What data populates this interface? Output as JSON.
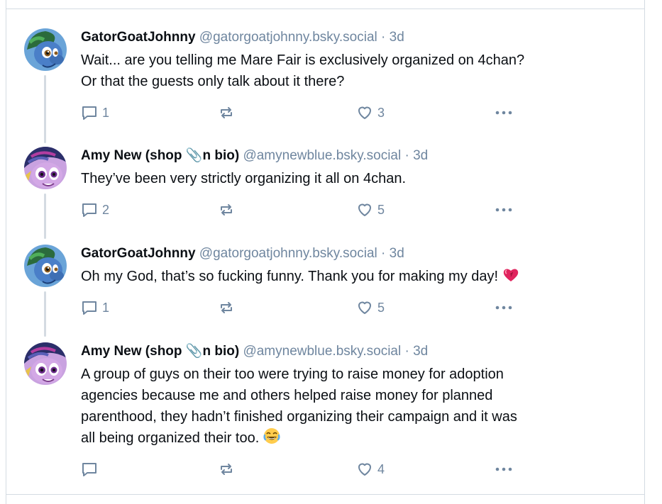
{
  "posts": [
    {
      "name": "GatorGoatJohnny",
      "handle": "@gatorgoatjohnny.bsky.social",
      "sep": "·",
      "time": "3d",
      "lines": [
        "Wait... are you telling me Mare Fair is exclusively organized on 4chan?",
        "Or that the guests only talk about it there?"
      ],
      "replies": "1",
      "reposts": "",
      "likes": "3"
    },
    {
      "name": "Amy New (shop 📎n bio)",
      "handle": "@amynewblue.bsky.social",
      "sep": "·",
      "time": "3d",
      "lines": [
        "They’ve been very strictly organizing it all on 4chan."
      ],
      "replies": "2",
      "reposts": "",
      "likes": "5"
    },
    {
      "name": "GatorGoatJohnny",
      "handle": "@gatorgoatjohnny.bsky.social",
      "sep": "·",
      "time": "3d",
      "lines": [
        "Oh my God, that’s so fucking funny. Thank you for making my day!"
      ],
      "replies": "1",
      "reposts": "",
      "likes": "5"
    },
    {
      "name": "Amy New (shop 📎n bio)",
      "handle": "@amynewblue.bsky.social",
      "sep": "·",
      "time": "3d",
      "lines": [
        "A group of guys on their too were trying to raise money for adoption",
        "agencies because me and others helped raise money for planned",
        "parenthood, they hadn’t finished organizing their campaign and it was",
        "all being organized their too."
      ],
      "replies": "",
      "reposts": "",
      "likes": "4"
    }
  ],
  "icons": {
    "reply": "reply-icon",
    "repost": "repost-icon",
    "like": "heart-icon",
    "more": "more-icon",
    "heart_emoji": "heart-emoji-icon",
    "laugh_emoji": "laughing-emoji-icon"
  },
  "colors": {
    "meta": "#6f869f",
    "border": "#d4dbe2",
    "text": "#0b0f14"
  }
}
